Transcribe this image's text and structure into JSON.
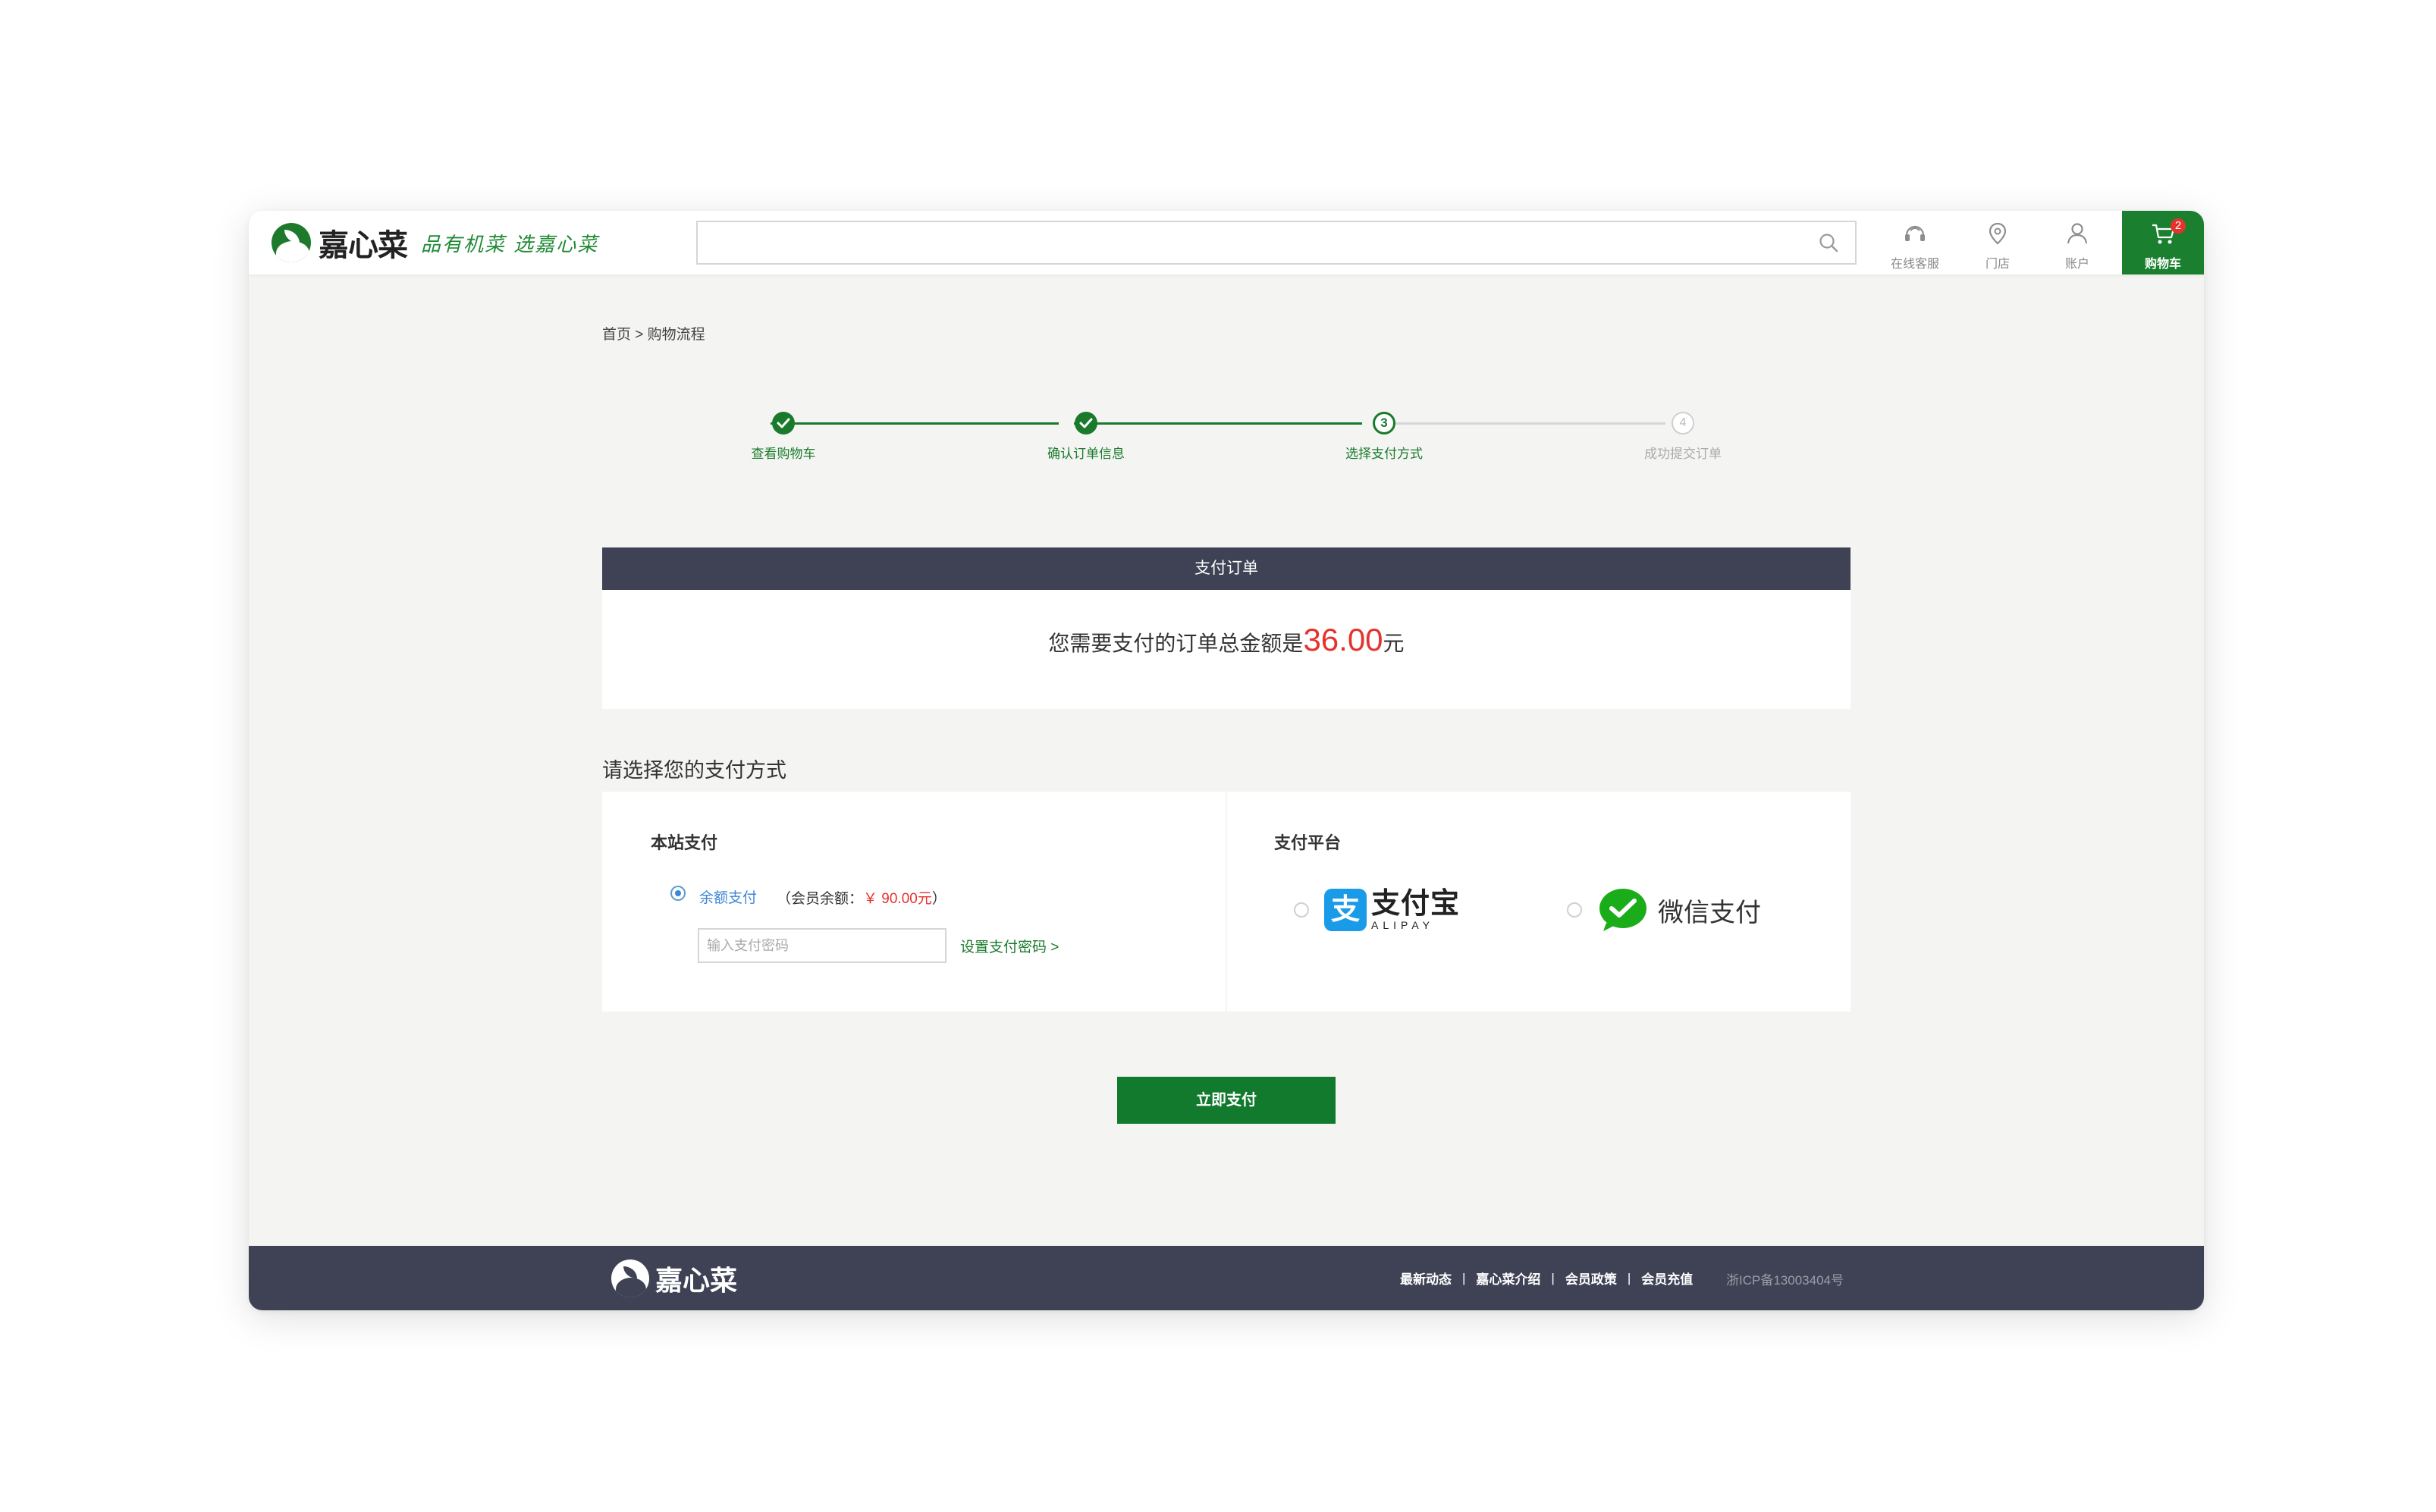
{
  "header": {
    "brand_name": "嘉心菜",
    "slogan": "品有机菜 选嘉心菜",
    "search_placeholder": "",
    "nav": [
      {
        "label": "在线客服",
        "icon": "headset-icon"
      },
      {
        "label": "门店",
        "icon": "location-pin-icon"
      },
      {
        "label": "账户",
        "icon": "user-icon"
      }
    ],
    "cart": {
      "label": "购物车",
      "count": "2",
      "icon": "cart-icon"
    }
  },
  "breadcrumb": "首页 > 购物流程",
  "steps": [
    {
      "label": "查看购物车",
      "state": "done"
    },
    {
      "label": "确认订单信息",
      "state": "done"
    },
    {
      "label": "选择支付方式",
      "number": "3",
      "state": "current"
    },
    {
      "label": "成功提交订单",
      "number": "4",
      "state": "todo"
    }
  ],
  "order_panel": {
    "title": "支付订单",
    "amount_prefix": "您需要支付的订单总金额是",
    "amount": "36.00",
    "amount_suffix": "元"
  },
  "payment": {
    "section_title": "请选择您的支付方式",
    "site": {
      "title": "本站支付",
      "balance_label": "余额支付",
      "balance_info_prefix": "（会员余额：",
      "balance_money": "￥ 90.00元",
      "balance_info_suffix": "）",
      "password_placeholder": "输入支付密码",
      "set_password_link": "设置支付密码 >"
    },
    "platform": {
      "title": "支付平台",
      "alipay_cn": "支付宝",
      "alipay_en": "ALIPAY",
      "alipay_glyph": "支",
      "wechat_label": "微信支付"
    }
  },
  "pay_button": "立即支付",
  "footer": {
    "brand_name": "嘉心菜",
    "links": [
      "最新动态",
      "嘉心菜介绍",
      "会员政策",
      "会员充值"
    ],
    "separator": "|",
    "icp": "浙ICP备13003404号"
  },
  "colors": {
    "brand_green": "#1a7a2c",
    "header_dark": "#3e4254",
    "amount_red": "#e5322d",
    "link_blue": "#3f86d6",
    "alipay_blue": "#1a9be8",
    "wechat_green": "#1aad19"
  }
}
